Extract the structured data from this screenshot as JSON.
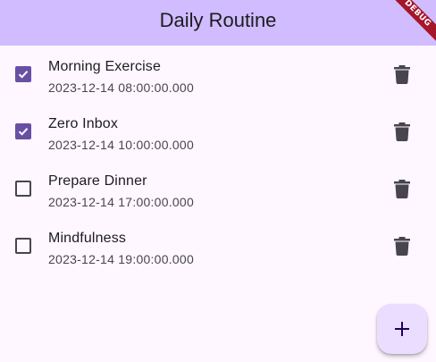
{
  "app_bar": {
    "title": "Daily Routine",
    "background_color": "#d0bcff"
  },
  "debug_banner": {
    "label": "DEBUG"
  },
  "tasks": [
    {
      "title": "Morning Exercise",
      "datetime": "2023-12-14 08:00:00.000",
      "checked": true,
      "delete_icon": "trash-icon"
    },
    {
      "title": "Zero Inbox",
      "datetime": "2023-12-14 10:00:00.000",
      "checked": true,
      "delete_icon": "trash-icon"
    },
    {
      "title": "Prepare Dinner",
      "datetime": "2023-12-14 17:00:00.000",
      "checked": false,
      "delete_icon": "trash-icon"
    },
    {
      "title": "Mindfulness",
      "datetime": "2023-12-14 19:00:00.000",
      "checked": false,
      "delete_icon": "trash-icon"
    }
  ],
  "fab": {
    "icon": "plus-icon",
    "background_color": "#eaddff"
  },
  "colors": {
    "checkbox_checked": "#6750a4",
    "checkbox_unchecked_border": "#49454f",
    "background": "#fef7ff",
    "icon": "#49454f"
  }
}
